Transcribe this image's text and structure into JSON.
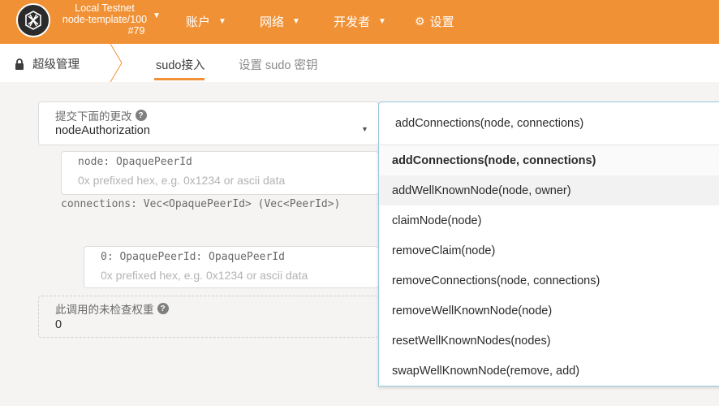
{
  "topbar": {
    "chain_name": "Local Testnet",
    "node_name": "node-template/100",
    "block": "#79",
    "nav": [
      {
        "label": "账户"
      },
      {
        "label": "网络"
      },
      {
        "label": "开发者"
      },
      {
        "label": "设置"
      }
    ],
    "bar_color": "#f19135"
  },
  "tabs": {
    "section": "超级管理",
    "items": [
      {
        "label": "sudo接入",
        "active": true
      },
      {
        "label": "设置 sudo 密钥",
        "active": false
      }
    ]
  },
  "form": {
    "pallet_label": "提交下面的更改",
    "pallet_value": "nodeAuthorization",
    "node_label": "node: OpaquePeerId",
    "node_placeholder": "0x prefixed hex, e.g. 0x1234 or ascii data",
    "connections_label": "connections: Vec<OpaquePeerId> (Vec<PeerId>)",
    "item0_label": "0: OpaquePeerId: OpaquePeerId",
    "item0_placeholder": "0x prefixed hex, e.g. 0x1234 or ascii data",
    "weight_label": "此调用的未检查权重",
    "weight_value": "0"
  },
  "dropdown": {
    "current": "addConnections(node, connections)",
    "options": [
      "addConnections(node, connections)",
      "addWellKnownNode(node, owner)",
      "claimNode(node)",
      "removeClaim(node)",
      "removeConnections(node, connections)",
      "removeWellKnownNode(node)",
      "resetWellKnownNodes(nodes)",
      "swapWellKnownNode(remove, add)"
    ]
  }
}
